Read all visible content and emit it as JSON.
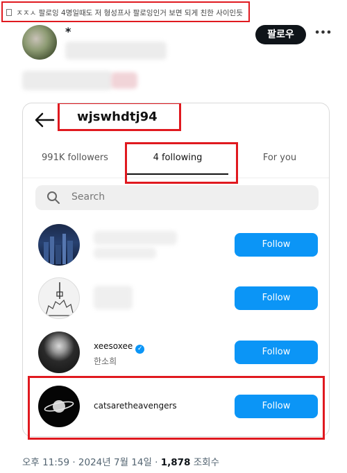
{
  "post": {
    "headline": "ㅈㅈㅅ 팔로잉 4명일때도 저 형성프사 팔로잉인거 보면 되게 친한 사이인듯",
    "author_mark": "*",
    "follow_label": "팔로우",
    "more_label": "•••",
    "meta": {
      "time": "오후 11:59 · 2024년 7월 14일 · ",
      "views": "1,878",
      "views_suffix": " 조회수"
    }
  },
  "screenshot": {
    "username": "wjswhdtj94",
    "tabs": [
      {
        "label": "991K followers"
      },
      {
        "label": "4 following"
      },
      {
        "label": "For you"
      }
    ],
    "search_placeholder": "Search",
    "rows": [
      {
        "name": "",
        "sub": "",
        "button": "Follow",
        "avatar": "city-night"
      },
      {
        "name": "",
        "sub": "",
        "button": "Follow",
        "avatar": "tower-sketch"
      },
      {
        "name": "xeesoxee",
        "sub": "한소희",
        "button": "Follow",
        "avatar": "portrait-bw",
        "verified": "✓"
      },
      {
        "name": "catsaretheavengers",
        "sub": "",
        "button": "Follow",
        "avatar": "saturn"
      }
    ]
  },
  "colors": {
    "highlight": "#e0191f",
    "follow_blue": "#0b95f6",
    "dark_button": "#0f1419"
  }
}
